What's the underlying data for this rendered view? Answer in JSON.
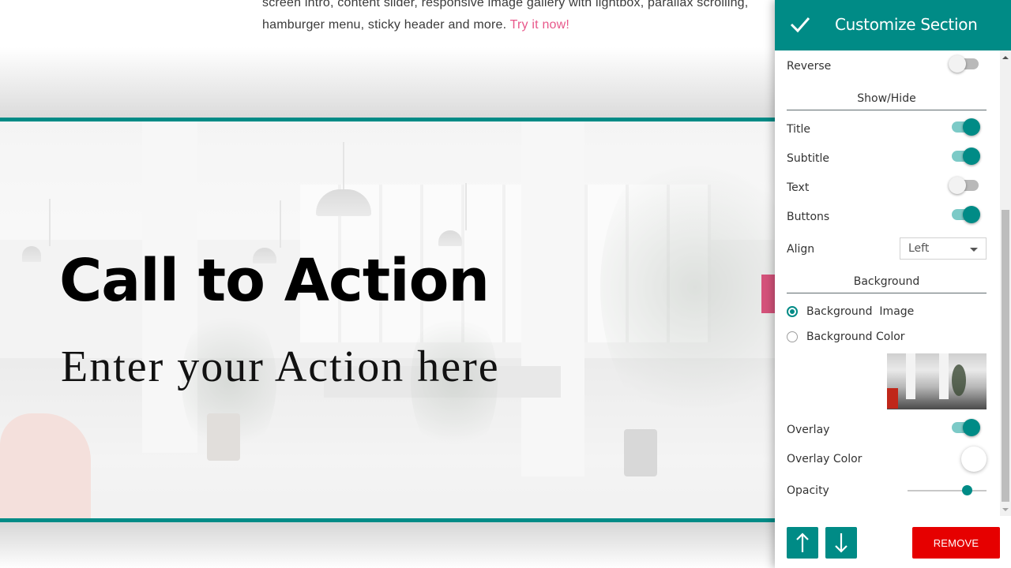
{
  "page": {
    "intro_line1": "screen intro, content slider, responsive image gallery with lightbox, parallax scrolling,",
    "intro_line2": "hamburger menu, sticky header and more. ",
    "intro_link": "Try it now!",
    "cta_title": "Call to Action",
    "cta_subtitle": "Enter your Action here"
  },
  "panel": {
    "title": "Customize Section",
    "confirm_icon": "check-icon",
    "reverse": {
      "label": "Reverse",
      "on": false
    },
    "show_hide_heading": "Show/Hide",
    "toggles": [
      {
        "label": "Title",
        "on": true
      },
      {
        "label": "Subtitle",
        "on": true
      },
      {
        "label": "Text",
        "on": false
      },
      {
        "label": "Buttons",
        "on": true
      }
    ],
    "align": {
      "label": "Align",
      "value": "Left"
    },
    "background_heading": "Background",
    "background_options": [
      {
        "label": "Background  Image",
        "checked": true
      },
      {
        "label": "Background Color",
        "checked": false
      }
    ],
    "overlay": {
      "label": "Overlay",
      "on": true
    },
    "overlay_color": {
      "label": "Overlay Color",
      "value": "#ffffff"
    },
    "opacity": {
      "label": "Opacity",
      "value_fraction": 0.75
    },
    "move_up_icon": "arrow-up-icon",
    "move_down_icon": "arrow-down-icon",
    "remove_label": "REMOVE"
  },
  "colors": {
    "accent": "#008b86",
    "link": "#e8578a",
    "remove": "#e60000",
    "cta_button": "#d5537b"
  }
}
